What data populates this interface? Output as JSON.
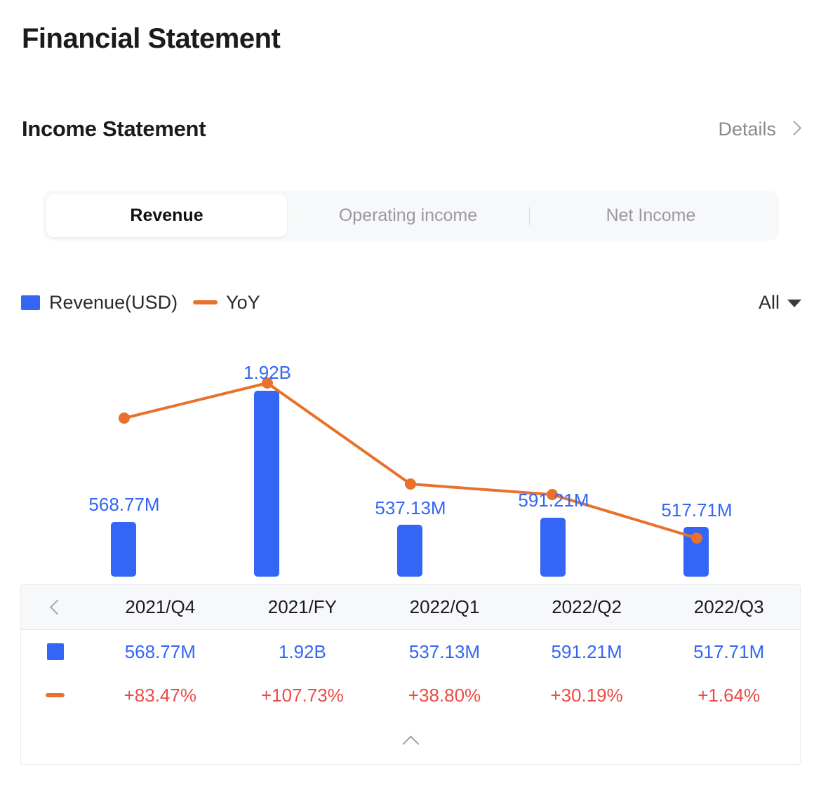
{
  "page": {
    "title": "Financial Statement"
  },
  "section": {
    "title": "Income Statement",
    "details_label": "Details",
    "details_icon": "chevron-right-icon"
  },
  "tabs": [
    {
      "label": "Revenue",
      "active": true
    },
    {
      "label": "Operating income",
      "active": false
    },
    {
      "label": "Net Income",
      "active": false
    }
  ],
  "legend": {
    "bar_label": "Revenue(USD)",
    "line_label": "YoY",
    "bar_color": "#3366f5",
    "line_color": "#e8712b"
  },
  "range_select": {
    "value": "All",
    "icon": "caret-down-icon"
  },
  "table": {
    "prev_icon": "chevron-left-icon",
    "collapse_icon": "chevron-up-icon",
    "periods": [
      "2021/Q4",
      "2021/FY",
      "2022/Q1",
      "2022/Q2",
      "2022/Q3"
    ],
    "revenue_row": [
      "568.77M",
      "1.92B",
      "537.13M",
      "591.21M",
      "517.71M"
    ],
    "yoy_row": [
      "+83.47%",
      "+107.73%",
      "+38.80%",
      "+30.19%",
      "+1.64%"
    ],
    "value_color": "#3366f5",
    "pct_color": "#ee4a45"
  },
  "chart_data": {
    "type": "bar",
    "title": "",
    "xlabel": "",
    "ylabel": "",
    "categories": [
      "2021/Q4",
      "2021/FY",
      "2022/Q1",
      "2022/Q2",
      "2022/Q3"
    ],
    "series": [
      {
        "name": "Revenue(USD)",
        "type": "bar",
        "color": "#3366f5",
        "labels": [
          "568.77M",
          "1.92B",
          "537.13M",
          "591.21M",
          "517.71M"
        ],
        "values": [
          568770000,
          1920000000,
          537130000,
          591210000,
          517710000
        ]
      },
      {
        "name": "YoY",
        "type": "line",
        "color": "#e8712b",
        "labels": [
          "+83.47%",
          "+107.73%",
          "+38.80%",
          "+30.19%",
          "+1.64%"
        ],
        "values": [
          83.47,
          107.73,
          38.8,
          30.19,
          1.64
        ]
      }
    ],
    "legend_position": "top-left",
    "grid": false,
    "bar_ylim": [
      0,
      1920000000
    ],
    "line_ylim": [
      0,
      120
    ]
  }
}
